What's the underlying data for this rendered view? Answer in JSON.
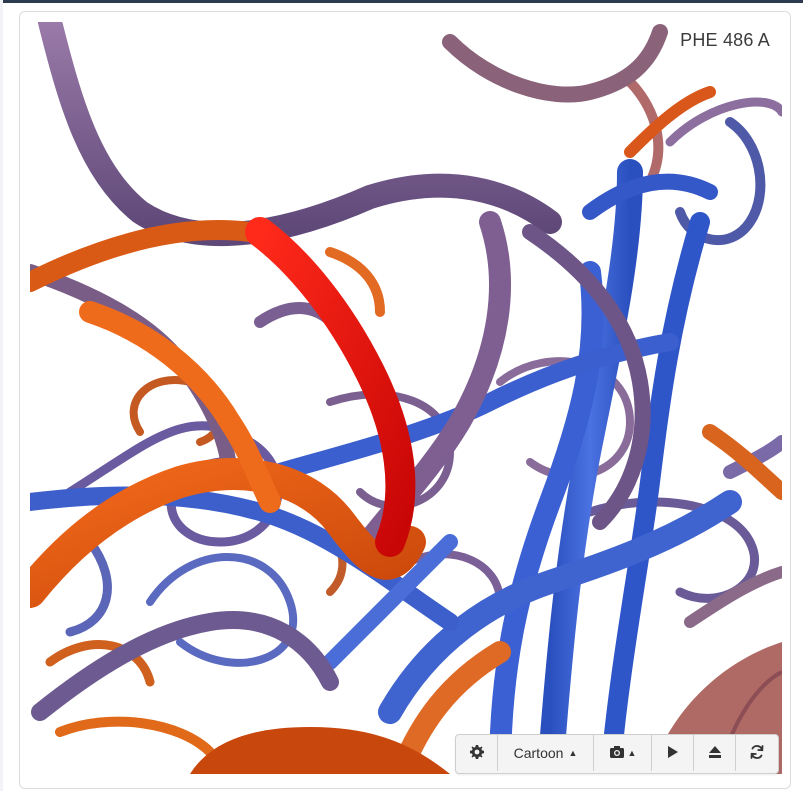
{
  "viewer": {
    "residue_label": "PHE 486 A",
    "representation": "cartoon",
    "colors": {
      "blue": "#3b5fcf",
      "purple": "#7d5f92",
      "mauve": "#8a6077",
      "orange": "#e25a12",
      "red": "#f20b0b",
      "rose": "#b46a69"
    }
  },
  "toolbar": {
    "settings_icon": "gear-icon",
    "style_label": "Cartoon",
    "snapshot_icon": "camera-icon",
    "play_icon": "play-icon",
    "eject_icon": "eject-icon",
    "reset_icon": "refresh-icon"
  }
}
